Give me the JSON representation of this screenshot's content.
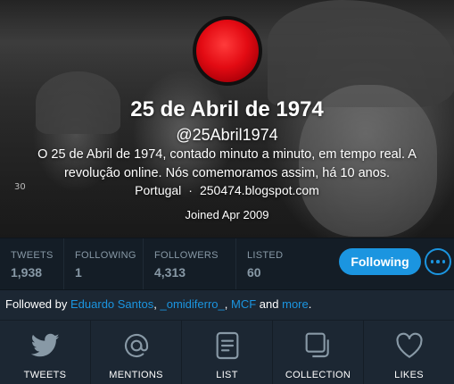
{
  "profile": {
    "name": "25 de Abril de 1974",
    "handle": "@25Abril1974",
    "bio": "O 25 de Abril de 1974, contado minuto a minuto, em tempo real. A revolução online. Nós comemoramos assim, há 10 anos.",
    "location": "Portugal",
    "separator": "·",
    "website": "250474.blogspot.com",
    "joined": "Joined Apr 2009",
    "header_mark": "30"
  },
  "stats": {
    "tweets": {
      "label": "TWEETS",
      "value": "1,938"
    },
    "following": {
      "label": "FOLLOWING",
      "value": "1"
    },
    "followers": {
      "label": "FOLLOWERS",
      "value": "4,313"
    },
    "listed": {
      "label": "LISTED",
      "value": "60"
    }
  },
  "actions": {
    "following_label": "Following"
  },
  "followed_by": {
    "prefix": "Followed by",
    "users": [
      "Eduardo Santos",
      "_omidiferro_",
      "MCF"
    ],
    "comma": ",",
    "and": "and",
    "more": "more",
    "period": "."
  },
  "tabs": [
    {
      "label": "TWEETS",
      "icon": "bird-icon"
    },
    {
      "label": "MENTIONS",
      "icon": "at-icon"
    },
    {
      "label": "LIST",
      "icon": "list-icon"
    },
    {
      "label": "COLLECTION",
      "icon": "collection-icon"
    },
    {
      "label": "LIKES",
      "icon": "heart-icon"
    }
  ],
  "colors": {
    "accent": "#1b95e0",
    "background": "#141d26",
    "panel": "#1c2733",
    "muted": "#8899a6",
    "avatar_red": "#e30b13"
  }
}
